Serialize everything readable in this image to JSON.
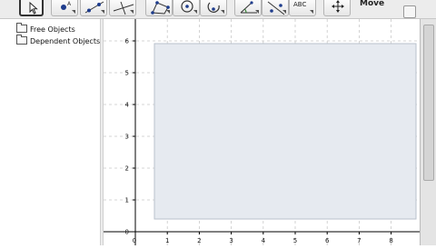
{
  "toolbar": {
    "move_label": "Move",
    "tools": [
      {
        "icon": "pointer-arrow-icon",
        "selected": true
      },
      {
        "icon": "new-point-icon"
      },
      {
        "icon": "line-through-two-points-icon"
      },
      {
        "icon": "perpendicular-line-icon"
      },
      {
        "icon": "polygon-icon"
      },
      {
        "icon": "circle-center-point-icon"
      },
      {
        "icon": "circle-arc-icon"
      },
      {
        "icon": "angle-icon"
      },
      {
        "icon": "reflect-about-line-icon"
      },
      {
        "icon": "insert-text-icon",
        "label": "ABC"
      },
      {
        "icon": "move-graphics-view-icon"
      }
    ]
  },
  "algebra": {
    "folders": [
      "Free Objects",
      "Dependent Objects"
    ]
  },
  "graphics": {
    "x_ticks": [
      "0",
      "1",
      "2",
      "3",
      "4",
      "5",
      "6",
      "7",
      "8"
    ],
    "y_ticks": [
      "0",
      "1",
      "2",
      "3",
      "4",
      "5",
      "6"
    ],
    "grid": true,
    "colors": {
      "grid": "#c8c8c8",
      "axis": "#000000",
      "selection_fill": "#e6eaf0",
      "selection_border": "#b9c2cc"
    }
  }
}
